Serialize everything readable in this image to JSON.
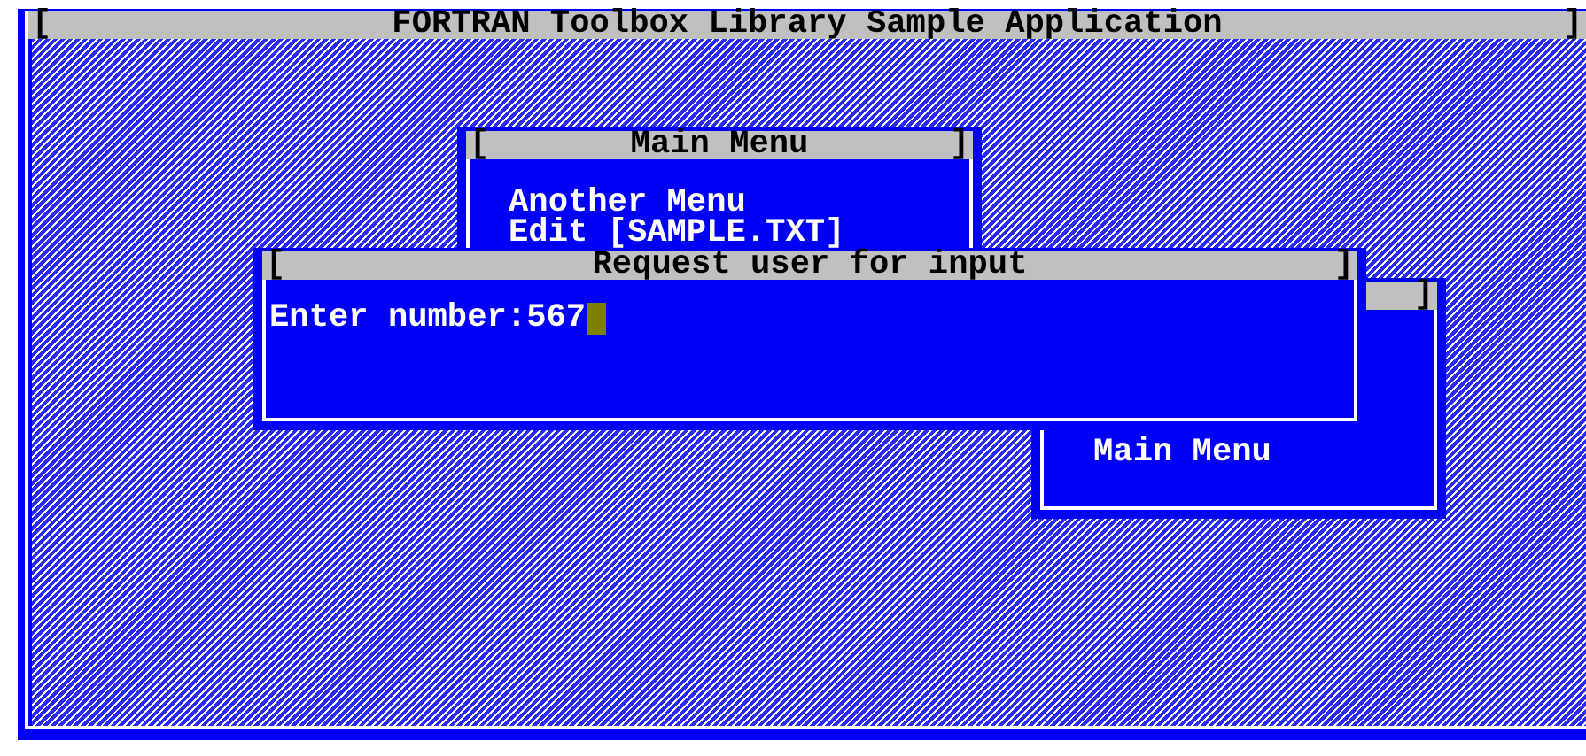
{
  "app": {
    "left_bracket": "[",
    "title": "FORTRAN Toolbox Library Sample Application",
    "right_bracket": "]"
  },
  "windows": [
    {
      "kind": "menu",
      "left_bracket": "[",
      "title": "Main Menu",
      "right_bracket": "]",
      "items": [
        "Another Menu",
        "Edit [SAMPLE.TXT]"
      ]
    },
    {
      "kind": "menu",
      "right_bracket": "]",
      "items": [
        "Main Menu"
      ]
    },
    {
      "kind": "prompt",
      "left_bracket": "[",
      "title": "Request user for input",
      "right_bracket": "]",
      "prompt": "Enter number:",
      "value": "567",
      "cursor": true
    }
  ]
}
